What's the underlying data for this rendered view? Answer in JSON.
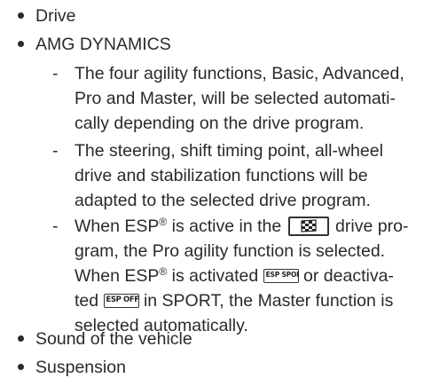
{
  "bullets": {
    "drive": "Drive",
    "amg_dynamics": "AMG DYNAMICS",
    "sound": "Sound of the vehicle",
    "suspension": "Suspension"
  },
  "sub_items": {
    "agility": {
      "dash": "-",
      "line1": "The four agility functions, Basic, Advanced,",
      "line2": "Pro and Master, will be selected automati-",
      "line3": "cally depending on the drive program."
    },
    "steering": {
      "dash": "-",
      "line1": "The steering, shift timing point, all-wheel",
      "line2": "drive and stabilization functions will be",
      "line3": "adapted to the selected drive program."
    },
    "esp": {
      "dash": "-",
      "l1_a": "When ESP",
      "reg": "®",
      "l1_b": " is active in the ",
      "l1_c": " drive pro-",
      "line2": "gram, the Pro agility function is selected.",
      "l3_a": "When ESP",
      "l3_b": " is activated ",
      "l3_c": " or deactiva-",
      "l4_a": "ted ",
      "l4_b": " in SPORT, the Master function is",
      "line5": "selected automatically."
    }
  },
  "symbols": {
    "flag_icon": "checkered-flag-icon",
    "esp_sport": "ESP SPORT",
    "esp_off": "ESP OFF"
  },
  "colors": {
    "text": "#2a2a2a",
    "background": "#ffffff"
  }
}
